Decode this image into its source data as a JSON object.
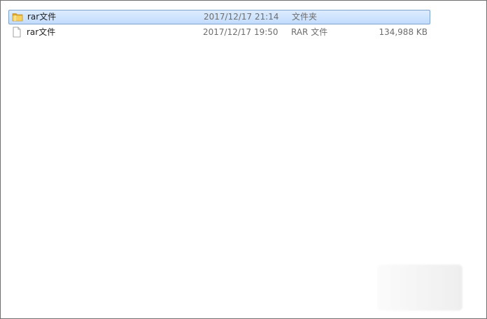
{
  "files": [
    {
      "name": "rar文件",
      "date": "2017/12/17 21:14",
      "type": "文件夹",
      "size": "",
      "icon": "folder-icon",
      "selected": true
    },
    {
      "name": "rar文件",
      "date": "2017/12/17 19:50",
      "type": "RAR 文件",
      "size": "134,988 KB",
      "icon": "file-icon",
      "selected": false
    }
  ],
  "colors": {
    "selection_fill": "#cce1fb",
    "selection_border": "#7da2ce",
    "meta_text": "#6d6d6d",
    "folder": "#e8b73a"
  }
}
